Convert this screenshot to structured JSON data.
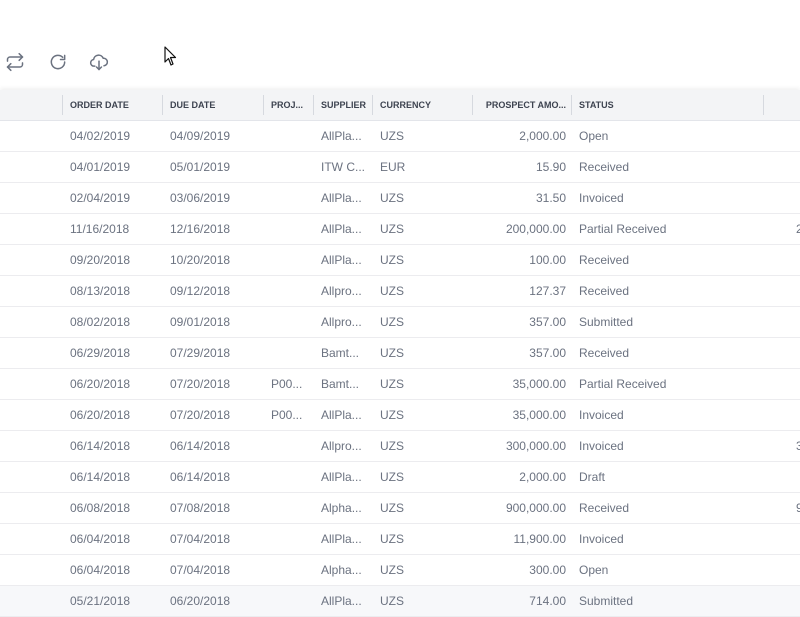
{
  "columns": {
    "order_date": "ORDER DATE",
    "due_date": "DUE DATE",
    "project": "PROJ...",
    "supplier": "SUPPLIER",
    "currency": "CURRENCY",
    "prospect_amount": "PROSPECT AMO...",
    "status": "STATUS"
  },
  "rows": [
    {
      "order_date": "04/02/2019",
      "due_date": "04/09/2019",
      "project": "",
      "supplier": "AllPla...",
      "currency": "UZS",
      "amount": "2,000.00",
      "status": "Open",
      "extra": ""
    },
    {
      "order_date": "04/01/2019",
      "due_date": "05/01/2019",
      "project": "",
      "supplier": "ITW C...",
      "currency": "EUR",
      "amount": "15.90",
      "status": "Received",
      "extra": ""
    },
    {
      "order_date": "02/04/2019",
      "due_date": "03/06/2019",
      "project": "",
      "supplier": "AllPla...",
      "currency": "UZS",
      "amount": "31.50",
      "status": "Invoiced",
      "extra": ""
    },
    {
      "order_date": "11/16/2018",
      "due_date": "12/16/2018",
      "project": "",
      "supplier": "AllPla...",
      "currency": "UZS",
      "amount": "200,000.00",
      "status": "Partial Received",
      "extra": "2"
    },
    {
      "order_date": "09/20/2018",
      "due_date": "10/20/2018",
      "project": "",
      "supplier": "AllPla...",
      "currency": "UZS",
      "amount": "100.00",
      "status": "Received",
      "extra": ""
    },
    {
      "order_date": "08/13/2018",
      "due_date": "09/12/2018",
      "project": "",
      "supplier": "Allpro...",
      "currency": "UZS",
      "amount": "127.37",
      "status": "Received",
      "extra": ""
    },
    {
      "order_date": "08/02/2018",
      "due_date": "09/01/2018",
      "project": "",
      "supplier": "Allpro...",
      "currency": "UZS",
      "amount": "357.00",
      "status": "Submitted",
      "extra": ""
    },
    {
      "order_date": "06/29/2018",
      "due_date": "07/29/2018",
      "project": "",
      "supplier": "Bamt...",
      "currency": "UZS",
      "amount": "357.00",
      "status": "Received",
      "extra": ""
    },
    {
      "order_date": "06/20/2018",
      "due_date": "07/20/2018",
      "project": "P00...",
      "supplier": "Bamt...",
      "currency": "UZS",
      "amount": "35,000.00",
      "status": "Partial Received",
      "extra": ""
    },
    {
      "order_date": "06/20/2018",
      "due_date": "07/20/2018",
      "project": "P00...",
      "supplier": "AllPla...",
      "currency": "UZS",
      "amount": "35,000.00",
      "status": "Invoiced",
      "extra": ""
    },
    {
      "order_date": "06/14/2018",
      "due_date": "06/14/2018",
      "project": "",
      "supplier": "Allpro...",
      "currency": "UZS",
      "amount": "300,000.00",
      "status": "Invoiced",
      "extra": "3"
    },
    {
      "order_date": "06/14/2018",
      "due_date": "06/14/2018",
      "project": "",
      "supplier": "AllPla...",
      "currency": "UZS",
      "amount": "2,000.00",
      "status": "Draft",
      "extra": ""
    },
    {
      "order_date": "06/08/2018",
      "due_date": "07/08/2018",
      "project": "",
      "supplier": "Alpha...",
      "currency": "UZS",
      "amount": "900,000.00",
      "status": "Received",
      "extra": "9"
    },
    {
      "order_date": "06/04/2018",
      "due_date": "07/04/2018",
      "project": "",
      "supplier": "AllPla...",
      "currency": "UZS",
      "amount": "11,900.00",
      "status": "Invoiced",
      "extra": ""
    },
    {
      "order_date": "06/04/2018",
      "due_date": "07/04/2018",
      "project": "",
      "supplier": "Alpha...",
      "currency": "UZS",
      "amount": "300.00",
      "status": "Open",
      "extra": ""
    },
    {
      "order_date": "05/21/2018",
      "due_date": "06/20/2018",
      "project": "",
      "supplier": "AllPla...",
      "currency": "UZS",
      "amount": "714.00",
      "status": "Submitted",
      "extra": ""
    }
  ],
  "icons": {
    "sync": "sync-icon",
    "refresh": "refresh-icon",
    "download": "cloud-download-icon"
  }
}
